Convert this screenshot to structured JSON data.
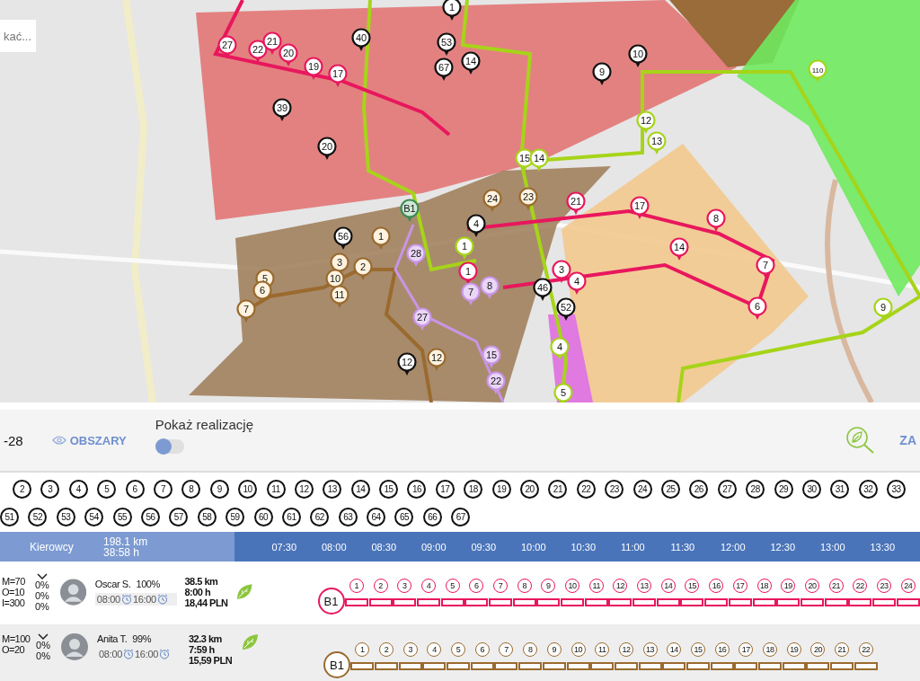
{
  "search": {
    "placeholder": "kać..."
  },
  "map": {
    "pins": [
      {
        "label": "40",
        "kind": "black"
      },
      {
        "label": "53",
        "kind": "black"
      },
      {
        "label": "39",
        "kind": "black"
      },
      {
        "label": "20",
        "kind": "black"
      },
      {
        "label": "67",
        "kind": "black"
      },
      {
        "label": "14",
        "kind": "black"
      },
      {
        "label": "10",
        "kind": "black"
      },
      {
        "label": "9",
        "kind": "black"
      },
      {
        "label": "56",
        "kind": "black"
      },
      {
        "label": "12",
        "kind": "black"
      },
      {
        "label": "46",
        "kind": "black"
      },
      {
        "label": "52",
        "kind": "black"
      },
      {
        "label": "1",
        "kind": "black"
      },
      {
        "label": "4",
        "kind": "black"
      },
      {
        "label": "27",
        "kind": "pink"
      },
      {
        "label": "22",
        "kind": "pink"
      },
      {
        "label": "21",
        "kind": "pink"
      },
      {
        "label": "20",
        "kind": "pink"
      },
      {
        "label": "19",
        "kind": "pink"
      },
      {
        "label": "17",
        "kind": "pink"
      },
      {
        "label": "17",
        "kind": "pink"
      },
      {
        "label": "21",
        "kind": "pink"
      },
      {
        "label": "8",
        "kind": "pink"
      },
      {
        "label": "7",
        "kind": "pink"
      },
      {
        "label": "14",
        "kind": "pink"
      },
      {
        "label": "3",
        "kind": "pink"
      },
      {
        "label": "4",
        "kind": "pink"
      },
      {
        "label": "1",
        "kind": "pink"
      },
      {
        "label": "6",
        "kind": "pink"
      },
      {
        "label": "110",
        "kind": "lime"
      },
      {
        "label": "12",
        "kind": "lime"
      },
      {
        "label": "13",
        "kind": "lime"
      },
      {
        "label": "9",
        "kind": "lime"
      },
      {
        "label": "15",
        "kind": "lime"
      },
      {
        "label": "14",
        "kind": "lime"
      },
      {
        "label": "5",
        "kind": "lime"
      },
      {
        "label": "4",
        "kind": "lime"
      },
      {
        "label": "1",
        "kind": "lime"
      },
      {
        "label": "1",
        "kind": "brown"
      },
      {
        "label": "3",
        "kind": "brown"
      },
      {
        "label": "2",
        "kind": "brown"
      },
      {
        "label": "5",
        "kind": "brown"
      },
      {
        "label": "6",
        "kind": "brown"
      },
      {
        "label": "7",
        "kind": "brown"
      },
      {
        "label": "10",
        "kind": "brown"
      },
      {
        "label": "11",
        "kind": "brown"
      },
      {
        "label": "12",
        "kind": "brown"
      },
      {
        "label": "24",
        "kind": "brown"
      },
      {
        "label": "23",
        "kind": "brown"
      },
      {
        "label": "28",
        "kind": "lilac"
      },
      {
        "label": "27",
        "kind": "lilac"
      },
      {
        "label": "7",
        "kind": "lilac"
      },
      {
        "label": "8",
        "kind": "lilac"
      },
      {
        "label": "15",
        "kind": "lilac"
      },
      {
        "label": "22",
        "kind": "lilac"
      },
      {
        "label": "B1",
        "kind": "depot"
      }
    ]
  },
  "toolbar": {
    "range": "-28",
    "areas_button": "OBSZARY",
    "show_realization": {
      "label": "Pokaż realizację",
      "on": false
    },
    "action": "ZA"
  },
  "stop_rows": [
    [
      "2",
      "3",
      "4",
      "5",
      "6",
      "7",
      "8",
      "9",
      "10",
      "11",
      "12",
      "13",
      "14",
      "15",
      "16",
      "17",
      "18",
      "19",
      "20",
      "21",
      "22",
      "23",
      "24",
      "25",
      "26",
      "27",
      "28",
      "29",
      "30",
      "31",
      "32",
      "33"
    ],
    [
      "51",
      "52",
      "53",
      "54",
      "55",
      "56",
      "57",
      "58",
      "59",
      "60",
      "61",
      "62",
      "63",
      "64",
      "65",
      "66",
      "67"
    ]
  ],
  "timeline": {
    "title": "Kierowcy",
    "total_distance": "198.1 km",
    "total_time": "38:58 h",
    "times": [
      "07:30",
      "08:00",
      "08:30",
      "09:00",
      "09:30",
      "10:00",
      "10:30",
      "11:00",
      "11:30",
      "12:00",
      "12:30",
      "13:00",
      "13:30"
    ]
  },
  "drivers": [
    {
      "limits": [
        "M=70",
        "O=10",
        "I=300"
      ],
      "usage": [
        "0%",
        "0%",
        "0%"
      ],
      "name": "Oscar S.",
      "score": "100%",
      "start": "08:00",
      "end": "16:00",
      "distance": "38.5 km",
      "duration": "8:00 h",
      "cost": "18,44 PLN",
      "route": "B1",
      "color": "#e8175d",
      "stops": [
        "1",
        "2",
        "3",
        "4",
        "5",
        "6",
        "7",
        "8",
        "9",
        "10",
        "11",
        "12",
        "13",
        "14",
        "15",
        "16",
        "17",
        "18",
        "19",
        "20",
        "21",
        "22",
        "23",
        "24"
      ]
    },
    {
      "limits": [
        "M=100",
        "O=20"
      ],
      "usage": [
        "0%",
        "0%"
      ],
      "name": "Anita T.",
      "score": "99%",
      "start": "08:00",
      "end": "16:00",
      "distance": "32.3 km",
      "duration": "7:59 h",
      "cost": "15,59 PLN",
      "route": "B1",
      "color": "#9a6a2e",
      "stops": [
        "1",
        "2",
        "3",
        "4",
        "5",
        "6",
        "7",
        "8",
        "9",
        "10",
        "11",
        "12",
        "13",
        "14",
        "15",
        "16",
        "17",
        "18",
        "19",
        "20",
        "21",
        "22"
      ]
    }
  ]
}
